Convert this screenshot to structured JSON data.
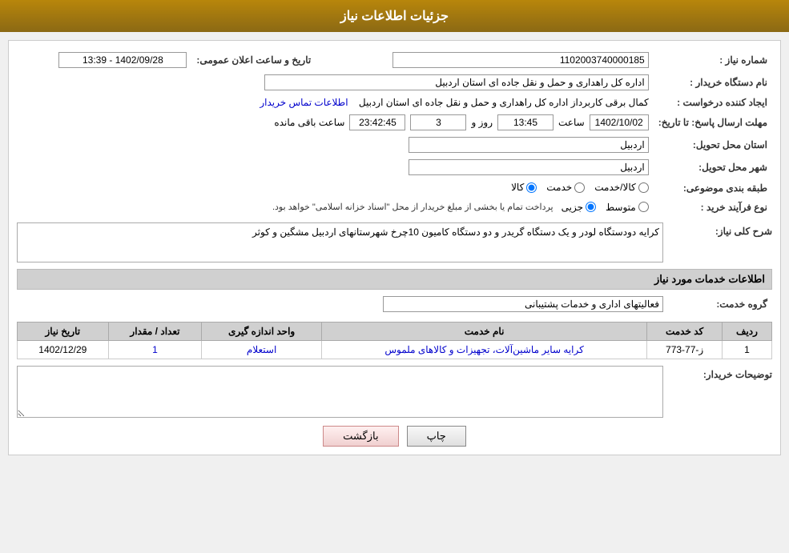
{
  "header": {
    "title": "جزئیات اطلاعات نیاز"
  },
  "fields": {
    "need_number_label": "شماره نیاز :",
    "need_number_value": "1102003740000185",
    "buyer_org_label": "نام دستگاه خریدار :",
    "buyer_org_value": "اداره کل راهداری و حمل و نقل جاده ای استان اردبیل",
    "creator_label": "ایجاد کننده درخواست :",
    "creator_value": "کمال برقی کاربرداز اداره کل راهداری و حمل و نقل جاده ای استان اردبیل",
    "contact_link": "اطلاعات تماس خریدار",
    "response_deadline_label": "مهلت ارسال پاسخ: تا تاریخ:",
    "date_value": "1402/10/02",
    "time_value": "13:45",
    "days_value": "3",
    "remaining_time_value": "23:42:45",
    "remaining_label": "ساعت باقی مانده",
    "announce_time_label": "تاریخ و ساعت اعلان عمومی:",
    "announce_time_value": "1402/09/28 - 13:39",
    "delivery_province_label": "استان محل تحویل:",
    "delivery_province_value": "اردبیل",
    "delivery_city_label": "شهر محل تحویل:",
    "delivery_city_value": "اردبیل",
    "category_label": "طبقه بندی موضوعی:",
    "category_options": [
      "کالا",
      "خدمت",
      "کالا/خدمت"
    ],
    "category_selected": "کالا",
    "process_type_label": "نوع فرآیند خرید :",
    "process_options": [
      "جزیی",
      "متوسط"
    ],
    "process_note": "پرداخت تمام یا بخشی از مبلغ خریدار از محل \"اسناد خزانه اسلامی\" خواهد بود.",
    "need_description_label": "شرح کلی نیاز:",
    "need_description_value": "کرایه دودستگاه لودر  و  یک دستگاه گریدر و دو دستگاه کامیون 10چرخ شهرستانهای اردبیل مشگین و کوثر",
    "services_section_label": "اطلاعات خدمات مورد نیاز",
    "service_group_label": "گروه خدمت:",
    "service_group_value": "فعالیتهای اداری و خدمات پشتیبانی",
    "table": {
      "columns": [
        "ردیف",
        "کد خدمت",
        "نام خدمت",
        "واحد اندازه گیری",
        "تعداد / مقدار",
        "تاریخ نیاز"
      ],
      "rows": [
        {
          "row": "1",
          "code": "ز-77-773",
          "name": "کرایه سایر ماشین‌آلات، تجهیزات و کالاهای ملموس",
          "unit": "استعلام",
          "count": "1",
          "date": "1402/12/29"
        }
      ]
    },
    "buyer_notes_label": "توضیحات خریدار:",
    "buyer_notes_value": ""
  },
  "buttons": {
    "print_label": "چاپ",
    "back_label": "بازگشت"
  }
}
